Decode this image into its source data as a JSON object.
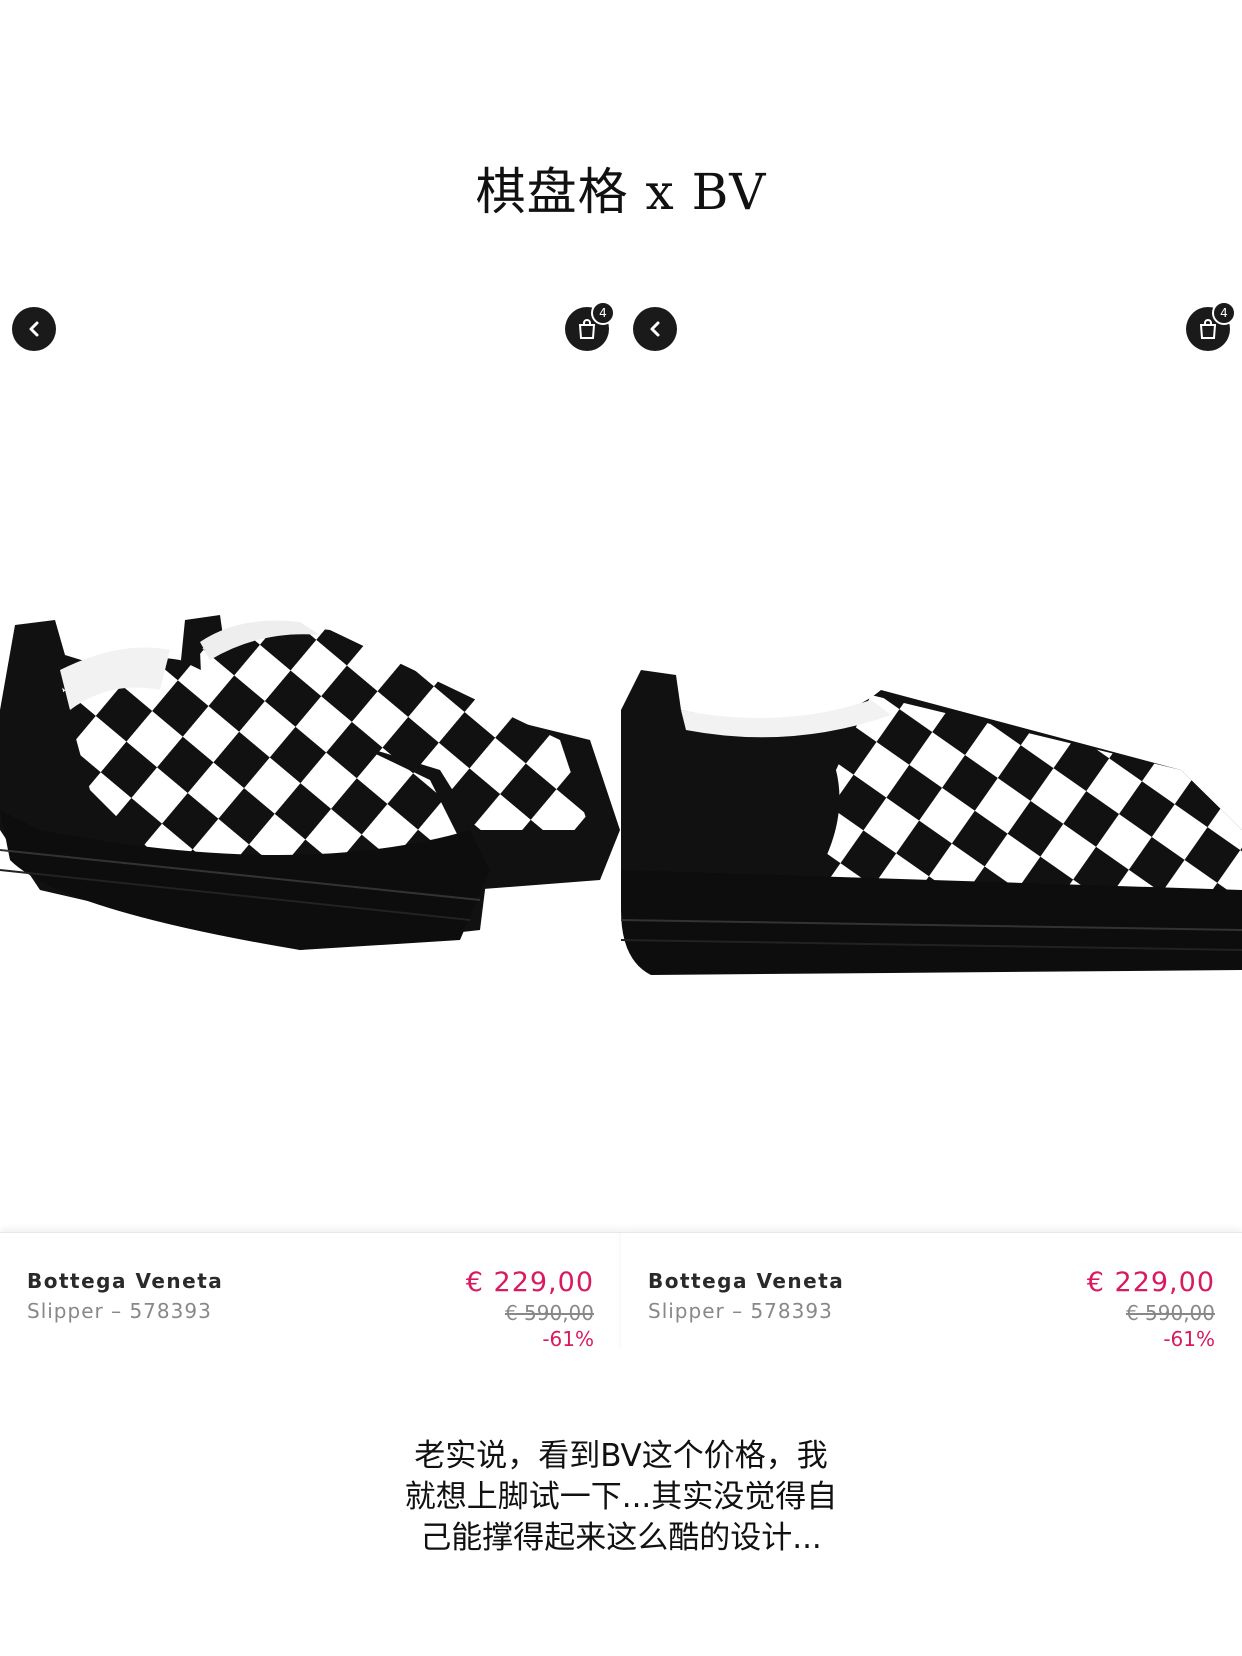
{
  "title": "棋盘格 x BV",
  "panels": [
    {
      "bag_count": "4",
      "brand": "Bottega Veneta",
      "model": "Slipper – 578393",
      "price": "€ 229,00",
      "old_price": "€ 590,00",
      "discount": "-61%"
    },
    {
      "bag_count": "4",
      "brand": "Bottega Veneta",
      "model": "Slipper – 578393",
      "price": "€ 229,00",
      "old_price": "€ 590,00",
      "discount": "-61%"
    }
  ],
  "caption": [
    "老实说，看到BV这个价格，我",
    "就想上脚试一下...其实没觉得自",
    "己能撑得起来这么酷的设计..."
  ],
  "colors": {
    "accent": "#d81b60",
    "dark": "#1a1a1a"
  }
}
